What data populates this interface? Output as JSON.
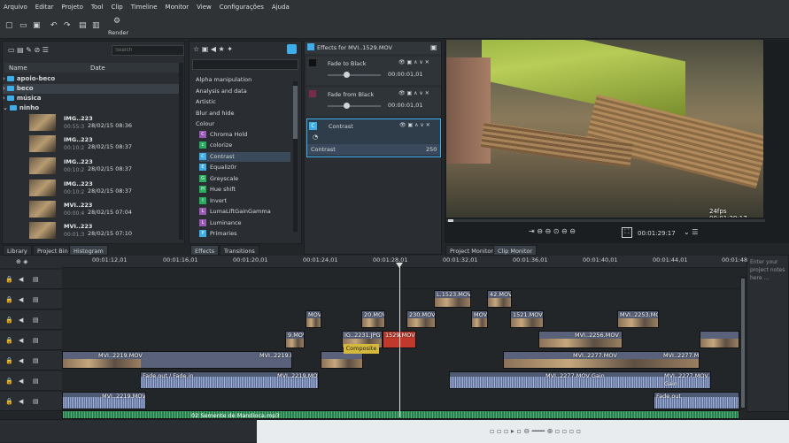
{
  "menu": [
    "Arquivo",
    "Editar",
    "Projeto",
    "Tool",
    "Clip",
    "Timeline",
    "Monitor",
    "View",
    "Configurações",
    "Ajuda"
  ],
  "toolbar": {
    "render_label": "Render"
  },
  "bin": {
    "search_placeholder": "Search",
    "col_name": "Name",
    "col_date": "Date",
    "folders": [
      "apoio-beco",
      "beco",
      "música",
      "ninho"
    ],
    "clips": [
      {
        "name": "IMG..223",
        "dur": "00:55:3",
        "date": "28/02/15 08:36"
      },
      {
        "name": "IMG..223",
        "dur": "00:10:2",
        "date": "28/02/15 08:37"
      },
      {
        "name": "IMG..223",
        "dur": "00:10:2",
        "date": "28/02/15 08:37"
      },
      {
        "name": "IMG..223",
        "dur": "00:10:2",
        "date": "28/02/15 08:37"
      },
      {
        "name": "MVI..223",
        "dur": "00:00:4",
        "date": "28/02/15 07:04"
      },
      {
        "name": "MVI..223",
        "dur": "00:01:3",
        "date": "28/02/15 07:10"
      }
    ],
    "tabs": [
      "Library",
      "Project Bin",
      "Histogram"
    ]
  },
  "effects_list": {
    "categories": [
      "Alpha manipulation",
      "Analysis and data",
      "Artistic",
      "Blur and hide",
      "Colour"
    ],
    "items": [
      {
        "label": "Chroma Hold",
        "icon": "C",
        "color": "#9b59b6"
      },
      {
        "label": "colorize",
        "icon": "c",
        "color": "#27ae60"
      },
      {
        "label": "Contrast",
        "icon": "C",
        "color": "#3daee9"
      },
      {
        "label": "Equaliz0r",
        "icon": "E",
        "color": "#3daee9"
      },
      {
        "label": "Greyscale",
        "icon": "G",
        "color": "#27ae60"
      },
      {
        "label": "Hue shift",
        "icon": "H",
        "color": "#27ae60"
      },
      {
        "label": "Invert",
        "icon": "I",
        "color": "#27ae60"
      },
      {
        "label": "LumaLiftGainGamma",
        "icon": "L",
        "color": "#9b59b6"
      },
      {
        "label": "Luminance",
        "icon": "L",
        "color": "#9b59b6"
      },
      {
        "label": "Primaries",
        "icon": "P",
        "color": "#3daee9"
      }
    ],
    "tabs": [
      "Effects",
      "Transitions"
    ]
  },
  "effect_stack": {
    "title": "Effects for MVI..1529.MOV",
    "effects": [
      {
        "name": "Fade to Black",
        "timecode": "00:00:01,01"
      },
      {
        "name": "Fade from Black",
        "timecode": "00:00:01,01"
      },
      {
        "name": "Contrast",
        "param": "Contrast",
        "value": "250"
      }
    ]
  },
  "monitor": {
    "overlay": "24fps 00:01:29:17",
    "timecode": "00:01:29:17",
    "tabs": [
      "Project Monitor",
      "Clip Monitor"
    ]
  },
  "timeline": {
    "ruler": [
      "00:01:12,01",
      "00:01:16,01",
      "00:01:20,01",
      "00:01:24,01",
      "00:01:28,01",
      "00:01:32,01",
      "00:01:36,01",
      "00:01:40,01",
      "00:01:44,01",
      "00:01:48"
    ],
    "clips": {
      "v4a": "L.1523.MOV",
      "v4b": "42.MOV",
      "v3a": "MOV",
      "v3b": "20.MOV",
      "v3c": "230.MOV",
      "v3d": "MOV",
      "v3e": "1521.MOV",
      "v3f": "MVI..2253.MOV",
      "v2a": "9.MOV",
      "v2b": "IG..2231.JPG",
      "v2c": "1529.MOV",
      "v2d": "MVI..2256.MOV",
      "v1a": "MVI..2219.MOV",
      "v1b": "MVI..2219.MOV",
      "v1c": "MVI..2277.MOV",
      "v1d": "MVI..2277.MOV",
      "a1a": "Fade out / Fade in",
      "a1b": "MVI..2219.MOV",
      "a1c": "MVI..2277.MOV Gain",
      "a1d": "MVI..2277.MOV Gain",
      "a2a": "MVI..2219.MOV",
      "a2b": "Fade out",
      "music": "02 Semente de Mandioca.mp3"
    },
    "composite": "Composite"
  },
  "notes": {
    "placeholder": "Enter your project notes here ..."
  }
}
